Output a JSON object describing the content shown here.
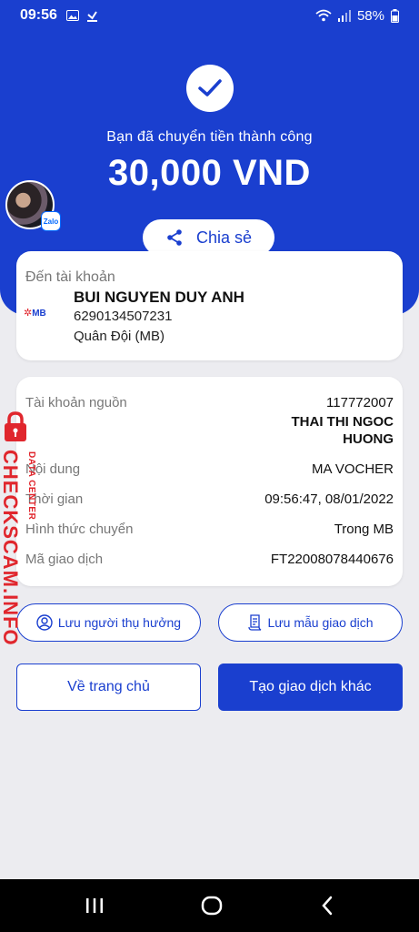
{
  "status_bar": {
    "time": "09:56",
    "battery": "58%"
  },
  "hero": {
    "success_text": "Bạn đã chuyển tiền thành công",
    "amount": "30,000 VND",
    "share_label": "Chia sẻ",
    "avatar_badge": "Zalo"
  },
  "destination": {
    "label": "Đến tài khoản",
    "bank_logo": "MB",
    "name": "BUI NGUYEN DUY ANH",
    "account": "6290134507231",
    "bank": "Quân Đội (MB)"
  },
  "details": {
    "source_label": "Tài khoản nguồn",
    "source_account": "117772007",
    "source_name_line1": "THAI THI NGOC",
    "source_name_line2": "HUONG",
    "content_label": "Nội dung",
    "content_value": "MA VOCHER",
    "time_label": "Thời gian",
    "time_value": "09:56:47, 08/01/2022",
    "method_label": "Hình thức chuyển",
    "method_value": "Trong MB",
    "txn_label": "Mã giao dịch",
    "txn_value": "FT22008078440676"
  },
  "actions": {
    "save_beneficiary": "Lưu người thụ hưởng",
    "save_template": "Lưu mẫu giao dịch",
    "home": "Về trang chủ",
    "new_transaction": "Tạo giao dịch khác"
  },
  "watermark": {
    "main": "CHECKSCAM.INFO",
    "sub": "DATA CENTER"
  },
  "colors": {
    "brand": "#1a3fcf",
    "watermark": "#e0262d"
  },
  "icons": [
    "image-icon",
    "download-icon",
    "wifi-icon",
    "signal-icon",
    "battery-icon",
    "check-icon",
    "share-icon",
    "user-circle-icon",
    "document-icon",
    "lock-icon",
    "recents-icon",
    "home-icon",
    "back-icon"
  ]
}
